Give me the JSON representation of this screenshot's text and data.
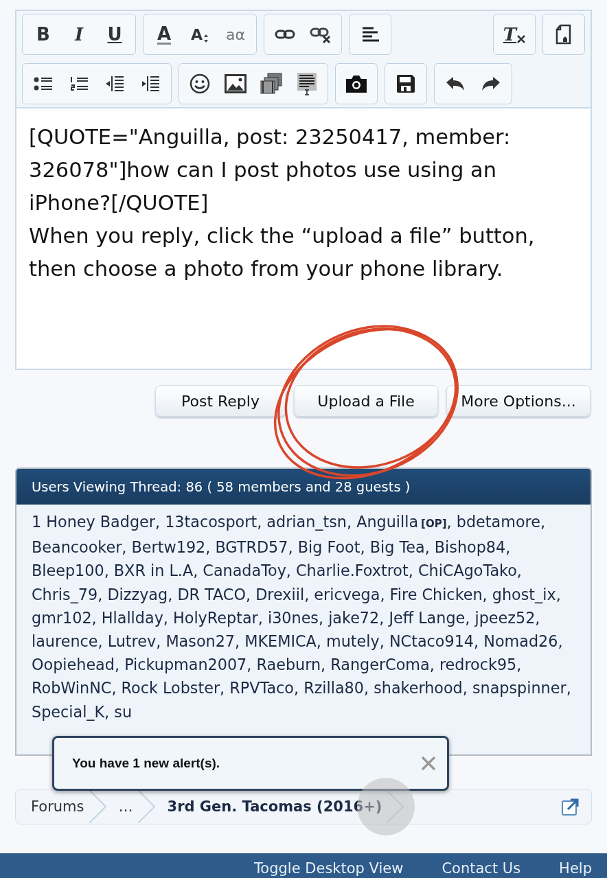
{
  "toolbar": {
    "rows": [
      {
        "groups": [
          [
            {
              "kind": "bold",
              "label": "B"
            },
            {
              "kind": "italic",
              "label": "I"
            },
            {
              "kind": "underline",
              "label": "U"
            }
          ],
          [
            {
              "kind": "font-color",
              "label": "A"
            },
            {
              "kind": "font-size",
              "label": "A"
            },
            {
              "kind": "text-style",
              "label": "aα"
            }
          ],
          [
            {
              "kind": "link"
            },
            {
              "kind": "unlink"
            }
          ],
          [
            {
              "kind": "align"
            }
          ]
        ],
        "end_groups": [
          [
            {
              "kind": "clear-format",
              "label": "T"
            }
          ],
          [
            {
              "kind": "page-tool"
            }
          ]
        ]
      },
      {
        "groups": [
          [
            {
              "kind": "bullets"
            },
            {
              "kind": "numbered"
            },
            {
              "kind": "outdent"
            },
            {
              "kind": "indent"
            }
          ],
          [
            {
              "kind": "smiley"
            },
            {
              "kind": "image"
            },
            {
              "kind": "media"
            },
            {
              "kind": "template"
            }
          ],
          [
            {
              "kind": "camera"
            }
          ],
          [
            {
              "kind": "save"
            }
          ],
          [
            {
              "kind": "undo"
            },
            {
              "kind": "redo"
            }
          ]
        ],
        "end_groups": []
      }
    ]
  },
  "editor": {
    "paragraphs": [
      "[QUOTE=\"Anguilla, post: 23250417, member: 326078\"]how can I post photos use using an iPhone?[/QUOTE]",
      "When you reply, click the “upload a file” button, then choose a photo from your phone library."
    ]
  },
  "buttons": [
    "Post Reply",
    "Upload a File",
    "More Options..."
  ],
  "users_viewing": {
    "title": "Users Viewing Thread: 86 ( 58 members and 28 guests )",
    "members": [
      {
        "name": "1 Honey Badger"
      },
      {
        "name": "13tacosport"
      },
      {
        "name": "adrian_tsn"
      },
      {
        "name": "Anguilla",
        "tag": "[OP]"
      },
      {
        "name": "bdetamore"
      },
      {
        "name": "Beancooker"
      },
      {
        "name": "Bertw192"
      },
      {
        "name": "BGTRD57"
      },
      {
        "name": "Big Foot"
      },
      {
        "name": "Big Tea"
      },
      {
        "name": "Bishop84"
      },
      {
        "name": "Bleep100"
      },
      {
        "name": "BXR in L.A"
      },
      {
        "name": "CanadaToy"
      },
      {
        "name": "Charlie.Foxtrot"
      },
      {
        "name": "ChiCAgoTako"
      },
      {
        "name": "Chris_79"
      },
      {
        "name": "Dizzyag"
      },
      {
        "name": "DR TACO"
      },
      {
        "name": "Drexiil"
      },
      {
        "name": "ericvega"
      },
      {
        "name": "Fire Chicken"
      },
      {
        "name": "ghost_ix"
      },
      {
        "name": "gmr102"
      },
      {
        "name": "Hlallday"
      },
      {
        "name": "HolyReptar"
      },
      {
        "name": "i30nes"
      },
      {
        "name": "jake72"
      },
      {
        "name": "Jeff Lange"
      },
      {
        "name": "jpeez52"
      },
      {
        "name": "laurence"
      },
      {
        "name": "Lutrev"
      },
      {
        "name": "Mason27"
      },
      {
        "name": "MKEMICA"
      },
      {
        "name": "mutely"
      },
      {
        "name": "NCtaco914"
      },
      {
        "name": "Nomad26"
      },
      {
        "name": "Oopiehead"
      },
      {
        "name": "Pickupman2007"
      },
      {
        "name": "Raeburn"
      },
      {
        "name": "RangerComa"
      },
      {
        "name": "redrock95"
      },
      {
        "name": "RobWinNC"
      },
      {
        "name": "Rock Lobster"
      },
      {
        "name": "RPVTaco"
      },
      {
        "name": "Rzilla80"
      },
      {
        "name": "shakerhood"
      },
      {
        "name": "snapspinner"
      },
      {
        "name": "Special_K"
      },
      {
        "name": "su"
      }
    ],
    "separator": ","
  },
  "alert": {
    "text": "You have 1 new alert(s)."
  },
  "breadcrumb": [
    {
      "label": "Forums",
      "current": false
    },
    {
      "label": "…",
      "current": false
    },
    {
      "label": "3rd Gen. Tacomas (2016+)",
      "current": true
    }
  ],
  "footer_links": [
    "Toggle Desktop View",
    "Contact Us",
    "Help"
  ]
}
